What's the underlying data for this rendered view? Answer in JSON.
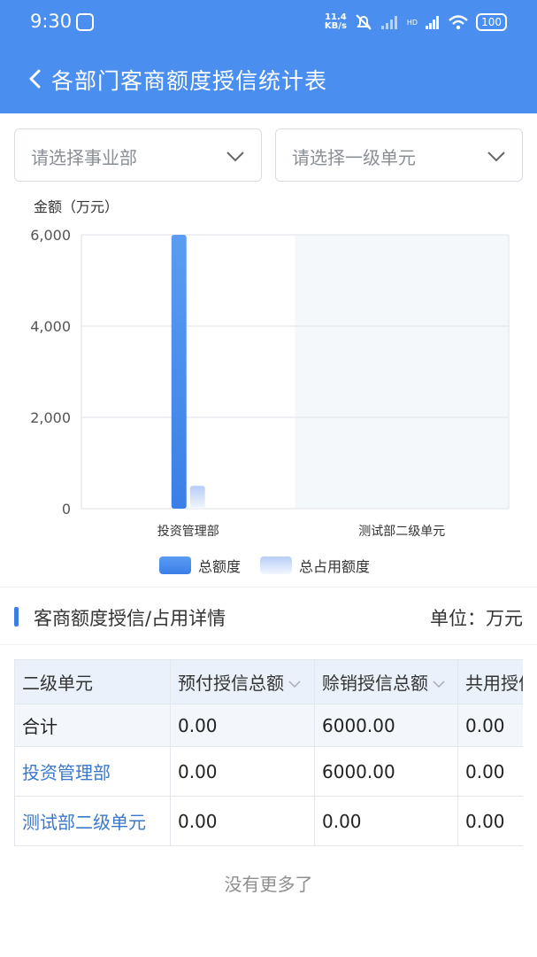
{
  "status_bar": {
    "time": "9:30",
    "speed_value": "11.4",
    "speed_unit": "KB/s",
    "network": "HD",
    "battery": "100"
  },
  "header": {
    "title": "各部门客商额度授信统计表"
  },
  "filters": {
    "business_unit_placeholder": "请选择事业部",
    "level1_unit_placeholder": "请选择一级单元"
  },
  "chart_data": {
    "type": "bar",
    "ylabel": "金额（万元）",
    "ylim": [
      0,
      6000
    ],
    "yticks": [
      "0",
      "2,000",
      "4,000",
      "6,000"
    ],
    "categories": [
      "投资管理部",
      "测试部二级单元"
    ],
    "series": [
      {
        "name": "总额度",
        "values": [
          6000,
          0
        ],
        "color": "#4a8ff0"
      },
      {
        "name": "总占用额度",
        "values": [
          500,
          0
        ],
        "color": "#c7d8f7"
      }
    ],
    "legend_position": "bottom",
    "grid": true
  },
  "details": {
    "title": "客商额度授信/占用详情",
    "unit": "单位：万元"
  },
  "table": {
    "columns": [
      "二级单元",
      "预付授信总额",
      "赊销授信总额",
      "共用授信"
    ],
    "rows": [
      [
        "合计",
        "0.00",
        "6000.00",
        "0.00"
      ],
      [
        "投资管理部",
        "0.00",
        "6000.00",
        "0.00"
      ],
      [
        "测试部二级单元",
        "0.00",
        "0.00",
        "0.00"
      ]
    ]
  },
  "footer": {
    "no_more": "没有更多了"
  }
}
